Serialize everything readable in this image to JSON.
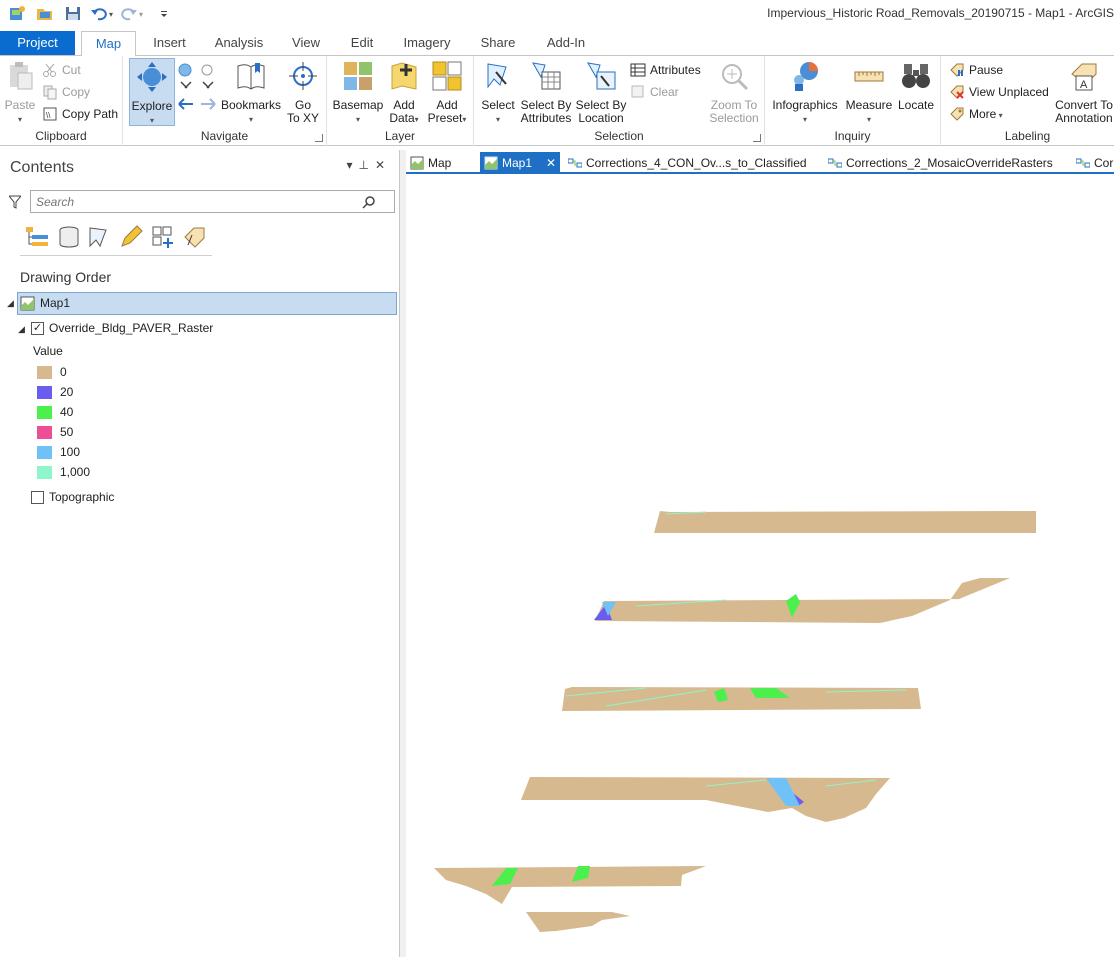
{
  "window": {
    "title": "Impervious_Historic Road_Removals_20190715 - Map1 - ArcGIS"
  },
  "ribbon_tabs": [
    "Project",
    "Map",
    "Insert",
    "Analysis",
    "View",
    "Edit",
    "Imagery",
    "Share",
    "Add-In"
  ],
  "ribbon": {
    "clipboard": {
      "label": "Clipboard",
      "paste": "Paste",
      "cut": "Cut",
      "copy": "Copy",
      "copy_path": "Copy Path"
    },
    "navigate": {
      "label": "Navigate",
      "explore": "Explore",
      "bookmarks": "Bookmarks",
      "go_to_xy_1": "Go",
      "go_to_xy_2": "To XY"
    },
    "layer": {
      "label": "Layer",
      "basemap": "Basemap",
      "add_data_1": "Add",
      "add_data_2": "Data",
      "add_preset_1": "Add",
      "add_preset_2": "Preset"
    },
    "selection": {
      "label": "Selection",
      "select": "Select",
      "select_by_attr_1": "Select By",
      "select_by_attr_2": "Attributes",
      "select_by_loc_1": "Select By",
      "select_by_loc_2": "Location",
      "attributes": "Attributes",
      "clear": "Clear",
      "zoom_to_sel_1": "Zoom To",
      "zoom_to_sel_2": "Selection"
    },
    "inquiry": {
      "label": "Inquiry",
      "infographics": "Infographics",
      "measure": "Measure",
      "locate": "Locate"
    },
    "labeling": {
      "label": "Labeling",
      "pause": "Pause",
      "view_unplaced": "View Unplaced",
      "more": "More",
      "convert_1": "Convert To",
      "convert_2": "Annotation"
    }
  },
  "contents": {
    "title": "Contents",
    "search_placeholder": "Search",
    "drawing_order": "Drawing Order",
    "map_name": "Map1",
    "layer_name": "Override_Bldg_PAVER_Raster",
    "legend_title": "Value",
    "legend": [
      {
        "label": "0",
        "color": "#d6b98e"
      },
      {
        "label": "20",
        "color": "#6b5cf0"
      },
      {
        "label": "40",
        "color": "#4cf04c"
      },
      {
        "label": "50",
        "color": "#ec4f96"
      },
      {
        "label": "100",
        "color": "#6fc1f7"
      },
      {
        "label": "1,000",
        "color": "#8ff5cc"
      }
    ],
    "basemap_layer": "Topographic"
  },
  "view_tabs": [
    {
      "label": "Map",
      "active": false
    },
    {
      "label": "Map1",
      "active": true
    },
    {
      "label": "Corrections_4_CON_Ov...s_to_Classified",
      "active": false
    },
    {
      "label": "Corrections_2_MosaicOverrideRasters",
      "active": false
    },
    {
      "label": "Cor",
      "active": false
    }
  ]
}
